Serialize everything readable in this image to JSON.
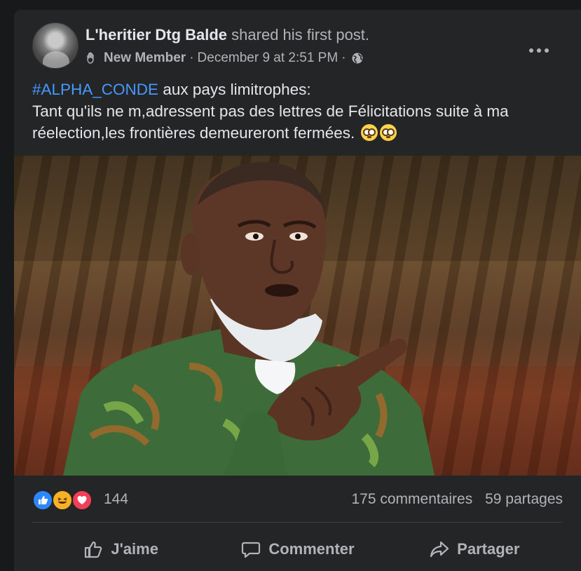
{
  "post": {
    "author": "L'heritier Dtg Balde",
    "action": "shared his first post.",
    "badge": "New Member",
    "separator": "·",
    "timestamp": "December 9 at 2:51 PM",
    "privacy_icon": "globe-icon",
    "more_icon": "more-options-icon",
    "hashtag": "#ALPHA_CONDE",
    "line1_rest": " aux pays limitrophes:",
    "line2": "Tant qu'ils ne m,adressent pas des lettres de Félicitations suite à ma réelection,les frontières demeureront fermées.",
    "emojis": [
      "flushed-face-emoji",
      "flushed-face-emoji"
    ],
    "image": "photo of a man in a green patterned shirt with a face mask under his chin, pointing forward"
  },
  "stats": {
    "reactions": [
      "like",
      "haha",
      "love"
    ],
    "reaction_count": "144",
    "comments": "175 commentaires",
    "shares": "59 partages"
  },
  "actions": {
    "like": "J'aime",
    "comment": "Commenter",
    "share": "Partager"
  },
  "colors": {
    "background": "#18191a",
    "card": "#242526",
    "text_primary": "#e4e6eb",
    "text_secondary": "#b0b3b8",
    "hashtag": "#4599ff",
    "like_blue": "#2d88ff",
    "love_red": "#f33e58",
    "haha_yellow": "#f7b125"
  }
}
